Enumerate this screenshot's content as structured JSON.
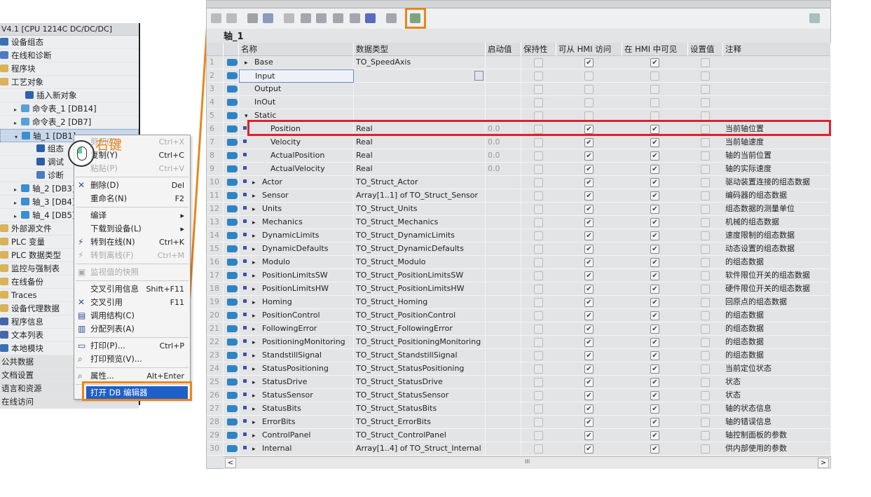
{
  "tree": {
    "header": "V4.1 [CPU 1214C DC/DC/DC]",
    "items": [
      {
        "label": "设备组态",
        "indent": 0,
        "icon": "device-config-icon",
        "color": "#3a6fb0"
      },
      {
        "label": "在线和诊断",
        "indent": 0,
        "icon": "online-diag-icon",
        "color": "#4b7cc2"
      },
      {
        "label": "程序块",
        "indent": 0,
        "icon": "folder-icon",
        "color": "#d9b25a"
      },
      {
        "label": "工艺对象",
        "indent": 0,
        "icon": "folder-icon",
        "color": "#d9b25a"
      },
      {
        "label": "插入新对象",
        "indent": 2,
        "icon": "add-object-icon",
        "color": "#3060b0"
      },
      {
        "label": "命令表_1 [DB14]",
        "indent": 1,
        "icon": "command-table-icon",
        "color": "#58a0d8",
        "arrow": "▸"
      },
      {
        "label": "命令表_2 [DB7]",
        "indent": 1,
        "icon": "command-table-icon",
        "color": "#58a0d8",
        "arrow": "▸"
      },
      {
        "label": "轴_1 [DB1]",
        "indent": 1,
        "icon": "axis-icon",
        "color": "#3a8fd0",
        "arrow": "▾",
        "selected": true
      },
      {
        "label": "组态",
        "indent": 3,
        "icon": "config-icon",
        "color": "#2b5fa8"
      },
      {
        "label": "调试",
        "indent": 3,
        "icon": "commissioning-icon",
        "color": "#2b5fa8"
      },
      {
        "label": "诊断",
        "indent": 3,
        "icon": "diagnostics-icon",
        "color": "#4b7cc2"
      },
      {
        "label": "轴_2 [DB3]",
        "indent": 1,
        "icon": "axis-icon",
        "color": "#3a8fd0",
        "arrow": "▸"
      },
      {
        "label": "轴_3 [DB4]",
        "indent": 1,
        "icon": "axis-icon",
        "color": "#3a8fd0",
        "arrow": "▸"
      },
      {
        "label": "轴_4 [DB5]",
        "indent": 1,
        "icon": "axis-icon",
        "color": "#3a8fd0",
        "arrow": "▸"
      },
      {
        "label": "外部源文件",
        "indent": 0,
        "icon": "folder-icon",
        "color": "#d9b25a"
      },
      {
        "label": "PLC 变量",
        "indent": 0,
        "icon": "folder-icon",
        "color": "#d9b25a"
      },
      {
        "label": "PLC 数据类型",
        "indent": 0,
        "icon": "folder-icon",
        "color": "#d9b25a"
      },
      {
        "label": "监控与强制表",
        "indent": 0,
        "icon": "folder-icon",
        "color": "#d9b25a"
      },
      {
        "label": "在线备份",
        "indent": 0,
        "icon": "folder-icon",
        "color": "#d9b25a"
      },
      {
        "label": "Traces",
        "indent": 0,
        "icon": "folder-icon",
        "color": "#d9b25a"
      },
      {
        "label": "设备代理数据",
        "indent": 0,
        "icon": "folder-icon",
        "color": "#d9b25a"
      },
      {
        "label": "程序信息",
        "indent": 0,
        "icon": "program-info-icon",
        "color": "#4466aa"
      },
      {
        "label": "文本列表",
        "indent": 0,
        "icon": "text-list-icon",
        "color": "#4466aa"
      },
      {
        "label": "本地模块",
        "indent": 0,
        "icon": "local-module-icon",
        "color": "#3a6fb0"
      },
      {
        "label": "公共数据",
        "indent": 0,
        "section": true
      },
      {
        "label": "文档设置",
        "indent": 0,
        "section": true
      },
      {
        "label": "语言和资源",
        "indent": 0,
        "section": true
      },
      {
        "label": "在线访问",
        "indent": 0,
        "section": true
      }
    ]
  },
  "annotation": "右键",
  "context_menu": {
    "items": [
      {
        "label": "剪切(T)",
        "shortcut": "Ctrl+X",
        "disabled": true,
        "icon": "cut-icon"
      },
      {
        "label": "复制(Y)",
        "shortcut": "Ctrl+C",
        "icon": "copy-icon"
      },
      {
        "label": "粘贴(P)",
        "shortcut": "Ctrl+V",
        "disabled": true,
        "icon": "paste-icon"
      },
      {
        "sep": true
      },
      {
        "label": "删除(D)",
        "shortcut": "Del",
        "icon": "delete-icon",
        "glyph": "✕"
      },
      {
        "label": "重命名(N)",
        "shortcut": "F2"
      },
      {
        "sep": true
      },
      {
        "label": "编译",
        "shortcut": "▸"
      },
      {
        "label": "下载到设备(L)",
        "shortcut": "▸"
      },
      {
        "label": "转到在线(N)",
        "shortcut": "Ctrl+K",
        "icon": "go-online-icon",
        "glyph": "⚡"
      },
      {
        "label": "转到离线(F)",
        "shortcut": "Ctrl+M",
        "disabled": true,
        "icon": "go-offline-icon",
        "glyph": "⚡"
      },
      {
        "sep": true
      },
      {
        "label": "监视值的快照",
        "disabled": true,
        "icon": "snapshot-icon",
        "glyph": "▣"
      },
      {
        "sep": true
      },
      {
        "label": "交叉引用信息",
        "shortcut": "Shift+F11"
      },
      {
        "label": "交叉引用",
        "shortcut": "F11",
        "icon": "cross-reference-icon",
        "glyph": "✕"
      },
      {
        "label": "调用结构(C)",
        "icon": "call-structure-icon",
        "glyph": "▤"
      },
      {
        "label": "分配列表(A)",
        "icon": "assignment-list-icon",
        "glyph": "▥"
      },
      {
        "sep": true
      },
      {
        "label": "打印(P)...",
        "shortcut": "Ctrl+P",
        "icon": "print-icon",
        "glyph": "▭"
      },
      {
        "label": "打印预览(V)...",
        "icon": "print-preview-icon",
        "glyph": "⌕"
      },
      {
        "sep": true
      },
      {
        "label": "属性...",
        "shortcut": "Alt+Enter",
        "icon": "properties-icon",
        "glyph": "⌕"
      },
      {
        "sep": true
      },
      {
        "label": "打开 DB 编辑器",
        "highlighted": true
      }
    ]
  },
  "editor": {
    "title": "轴_1",
    "columns": [
      "",
      "",
      "名称",
      "数据类型",
      "启动值",
      "保持性",
      "可从 HMI 访问",
      "在 HMI 中可见",
      "设置值",
      "注释"
    ],
    "rows": [
      {
        "n": "1",
        "name": "Base",
        "exp": "▸",
        "lvl": 0,
        "type": "TO_SpeedAxis",
        "start": "",
        "acc": true,
        "vis": true,
        "cmt": ""
      },
      {
        "n": "2",
        "name": "Input",
        "exp": "",
        "lvl": 0,
        "type": "",
        "start": "",
        "acc": false,
        "vis": false,
        "cmt": "",
        "editing": true
      },
      {
        "n": "3",
        "name": "Output",
        "exp": "",
        "lvl": 0,
        "type": "",
        "start": "",
        "acc": false,
        "vis": false,
        "cmt": ""
      },
      {
        "n": "4",
        "name": "InOut",
        "exp": "",
        "lvl": 0,
        "type": "",
        "start": "",
        "acc": false,
        "vis": false,
        "cmt": ""
      },
      {
        "n": "5",
        "name": "Static",
        "exp": "▾",
        "lvl": 0,
        "type": "",
        "start": "",
        "acc": false,
        "vis": false,
        "cmt": ""
      },
      {
        "n": "6",
        "name": "Position",
        "exp": "",
        "lvl": 1,
        "type": "Real",
        "start": "0.0",
        "acc": true,
        "vis": true,
        "cmt": "当前轴位置"
      },
      {
        "n": "7",
        "name": "Velocity",
        "exp": "",
        "lvl": 1,
        "type": "Real",
        "start": "0.0",
        "acc": true,
        "vis": true,
        "cmt": "当前轴速度"
      },
      {
        "n": "8",
        "name": "ActualPosition",
        "exp": "",
        "lvl": 1,
        "type": "Real",
        "start": "0.0",
        "acc": true,
        "vis": true,
        "cmt": "轴的当前位置"
      },
      {
        "n": "9",
        "name": "ActualVelocity",
        "exp": "",
        "lvl": 1,
        "type": "Real",
        "start": "0.0",
        "acc": true,
        "vis": true,
        "cmt": "轴的实际速度"
      },
      {
        "n": "10",
        "name": "Actor",
        "exp": "▸",
        "lvl": 1,
        "type": "TO_Struct_Actor",
        "start": "",
        "acc": true,
        "vis": true,
        "cmt": "驱动装置连接的组态数据"
      },
      {
        "n": "11",
        "name": "Sensor",
        "exp": "▸",
        "lvl": 1,
        "type": "Array[1..1] of TO_Struct_Sensor",
        "start": "",
        "acc": true,
        "vis": true,
        "cmt": "编码器的组态数据"
      },
      {
        "n": "12",
        "name": "Units",
        "exp": "▸",
        "lvl": 1,
        "type": "TO_Struct_Units",
        "start": "",
        "acc": true,
        "vis": true,
        "cmt": "组态数据的测量单位"
      },
      {
        "n": "13",
        "name": "Mechanics",
        "exp": "▸",
        "lvl": 1,
        "type": "TO_Struct_Mechanics",
        "start": "",
        "acc": true,
        "vis": true,
        "cmt": "机械的组态数据"
      },
      {
        "n": "14",
        "name": "DynamicLimits",
        "exp": "▸",
        "lvl": 1,
        "type": "TO_Struct_DynamicLimits",
        "start": "",
        "acc": true,
        "vis": true,
        "cmt": "速度限制的组态数据"
      },
      {
        "n": "15",
        "name": "DynamicDefaults",
        "exp": "▸",
        "lvl": 1,
        "type": "TO_Struct_DynamicDefaults",
        "start": "",
        "acc": true,
        "vis": true,
        "cmt": "动态设置的组态数据"
      },
      {
        "n": "16",
        "name": "Modulo",
        "exp": "▸",
        "lvl": 1,
        "type": "TO_Struct_Modulo",
        "start": "",
        "acc": true,
        "vis": true,
        "cmt": "的组态数据"
      },
      {
        "n": "17",
        "name": "PositionLimitsSW",
        "exp": "▸",
        "lvl": 1,
        "type": "TO_Struct_PositionLimitsSW",
        "start": "",
        "acc": true,
        "vis": true,
        "cmt": "软件限位开关的组态数据"
      },
      {
        "n": "18",
        "name": "PositionLimitsHW",
        "exp": "▸",
        "lvl": 1,
        "type": "TO_Struct_PositionLimitsHW",
        "start": "",
        "acc": true,
        "vis": true,
        "cmt": "硬件限位开关的组态数据"
      },
      {
        "n": "19",
        "name": "Homing",
        "exp": "▸",
        "lvl": 1,
        "type": "TO_Struct_Homing",
        "start": "",
        "acc": true,
        "vis": true,
        "cmt": "回原点的组态数据"
      },
      {
        "n": "20",
        "name": "PositionControl",
        "exp": "▸",
        "lvl": 1,
        "type": "TO_Struct_PositionControl",
        "start": "",
        "acc": true,
        "vis": true,
        "cmt": "的组态数据"
      },
      {
        "n": "21",
        "name": "FollowingError",
        "exp": "▸",
        "lvl": 1,
        "type": "TO_Struct_FollowingError",
        "start": "",
        "acc": true,
        "vis": true,
        "cmt": "的组态数据"
      },
      {
        "n": "22",
        "name": "PositioningMonitoring",
        "exp": "▸",
        "lvl": 1,
        "type": "TO_Struct_PositioningMonitoring",
        "start": "",
        "acc": true,
        "vis": true,
        "cmt": "的组态数据"
      },
      {
        "n": "23",
        "name": "StandstillSignal",
        "exp": "▸",
        "lvl": 1,
        "type": "TO_Struct_StandstillSignal",
        "start": "",
        "acc": true,
        "vis": true,
        "cmt": "的组态数据"
      },
      {
        "n": "24",
        "name": "StatusPositioning",
        "exp": "▸",
        "lvl": 1,
        "type": "TO_Struct_StatusPositioning",
        "start": "",
        "acc": true,
        "vis": true,
        "cmt": "当前定位状态"
      },
      {
        "n": "25",
        "name": "StatusDrive",
        "exp": "▸",
        "lvl": 1,
        "type": "TO_Struct_StatusDrive",
        "start": "",
        "acc": true,
        "vis": true,
        "cmt": "状态"
      },
      {
        "n": "26",
        "name": "StatusSensor",
        "exp": "▸",
        "lvl": 1,
        "type": "TO_Struct_StatusSensor",
        "start": "",
        "acc": true,
        "vis": true,
        "cmt": "状态"
      },
      {
        "n": "27",
        "name": "StatusBits",
        "exp": "▸",
        "lvl": 1,
        "type": "TO_Struct_StatusBits",
        "start": "",
        "acc": true,
        "vis": true,
        "cmt": "轴的状态信息"
      },
      {
        "n": "28",
        "name": "ErrorBits",
        "exp": "▸",
        "lvl": 1,
        "type": "TO_Struct_ErrorBits",
        "start": "",
        "acc": true,
        "vis": true,
        "cmt": "轴的错误信息"
      },
      {
        "n": "29",
        "name": "ControlPanel",
        "exp": "▸",
        "lvl": 1,
        "type": "TO_Struct_ControlPanel",
        "start": "",
        "acc": true,
        "vis": true,
        "cmt": "轴控制面板的参数"
      },
      {
        "n": "30",
        "name": "Internal",
        "exp": "▸",
        "lvl": 1,
        "type": "Array[1..4] of TO_Struct_Internal",
        "start": "",
        "acc": true,
        "vis": true,
        "cmt": "供内部使用的参数"
      }
    ],
    "scroll_mid": "III"
  },
  "colors": {
    "highlight_orange": "#e8861a",
    "highlight_red": "#e0202a",
    "menu_selected": "#1f5fc8"
  }
}
